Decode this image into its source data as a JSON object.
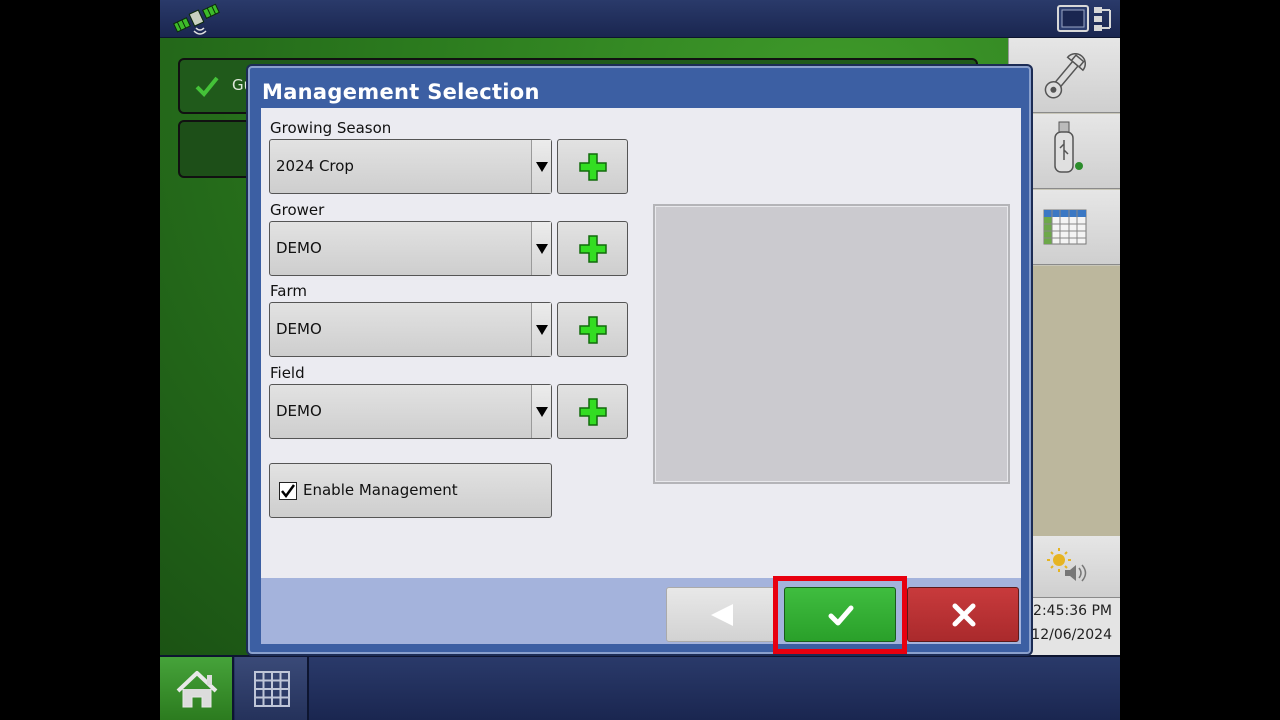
{
  "background": {
    "card_text": "Gu"
  },
  "dialog": {
    "title": "Management Selection",
    "fields": [
      {
        "label": "Growing Season",
        "value": "2024 Crop"
      },
      {
        "label": "Grower",
        "value": "DEMO"
      },
      {
        "label": "Farm",
        "value": "DEMO"
      },
      {
        "label": "Field",
        "value": "DEMO"
      }
    ],
    "enable_management": {
      "label": "Enable Management",
      "checked": true
    },
    "buttons": {
      "back_icon": "left-triangle-icon",
      "ok_icon": "checkmark-icon",
      "cancel_icon": "x-icon"
    }
  },
  "status": {
    "time": "2:45:36 PM",
    "date": "12/06/2024"
  },
  "colors": {
    "ok_green": "#2fb02f",
    "cancel_red": "#b83234",
    "highlight_red": "#e8000f",
    "dialog_blue": "#3c5fa3"
  },
  "icons": {
    "top_left": "gps-satellite-icon",
    "top_right": "display-layout-icon",
    "side": [
      "wrench-icon",
      "usb-drive-icon",
      "table-grid-icon",
      "brightness-volume-icon"
    ],
    "bottom": [
      "home-icon",
      "apps-grid-icon"
    ],
    "add": "plus-icon"
  }
}
